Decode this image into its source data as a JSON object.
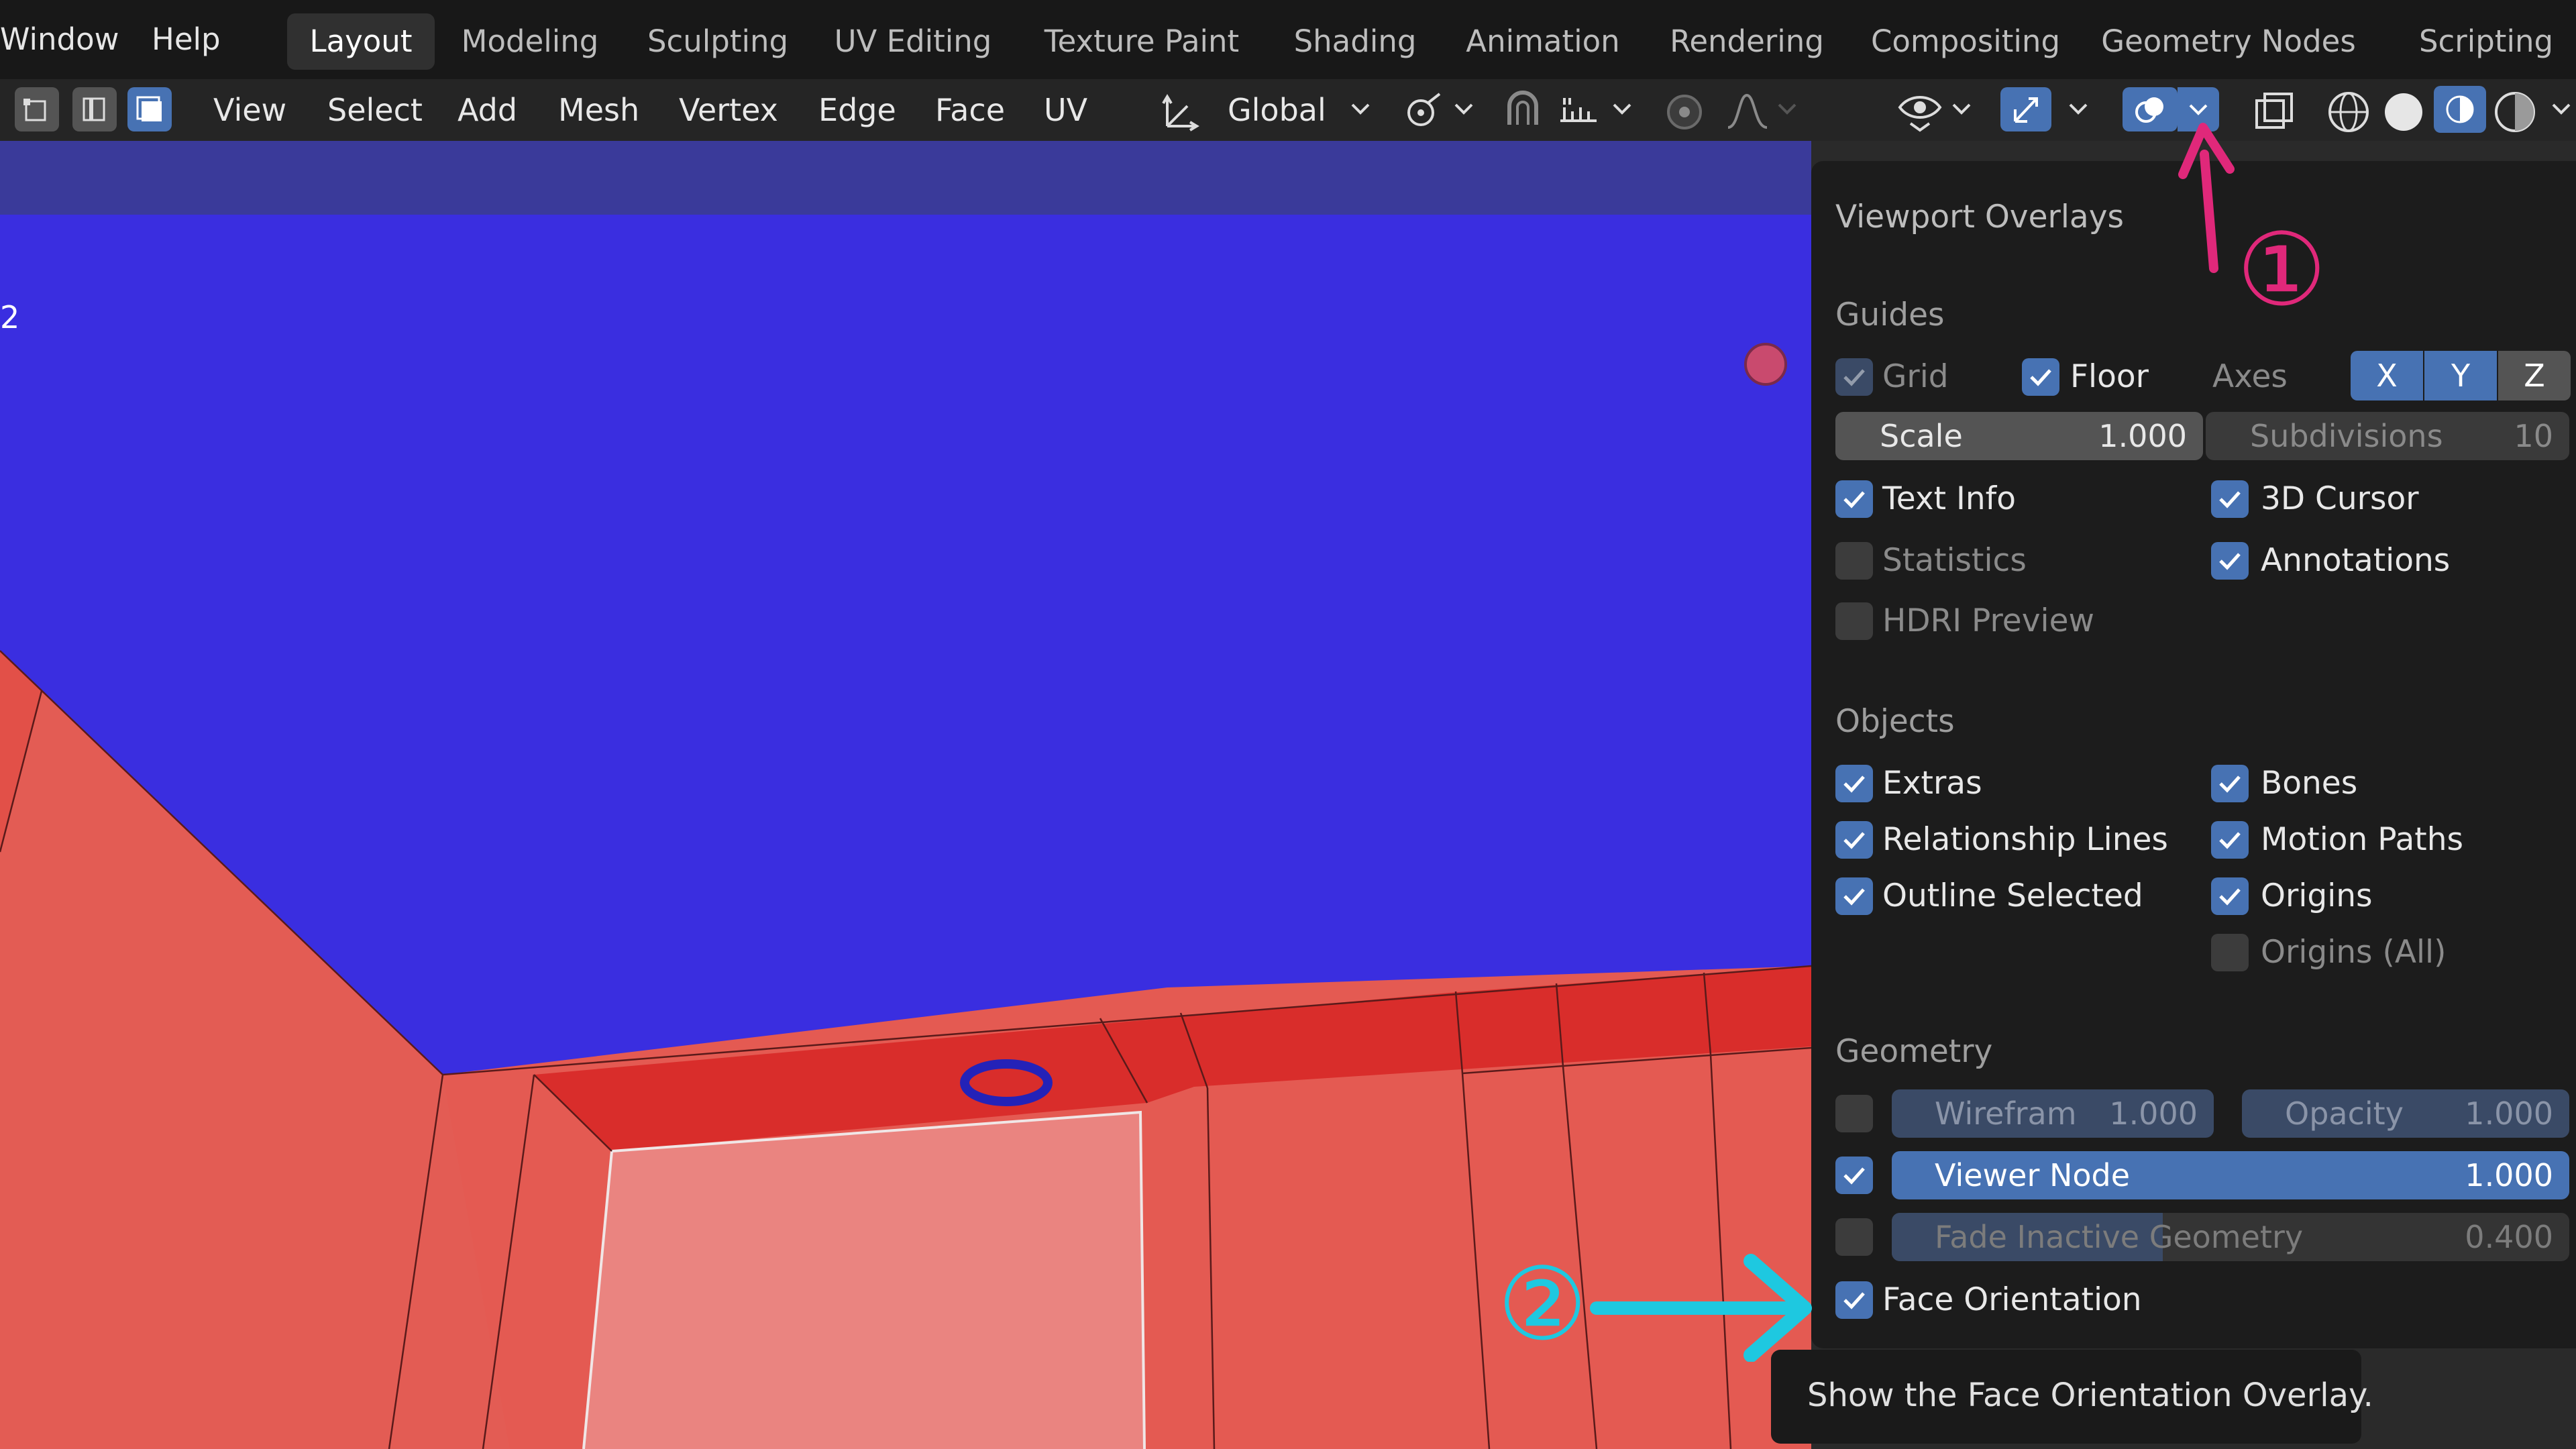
{
  "menubar": {
    "window": "Window",
    "help": "Help",
    "workspaces": [
      "Layout",
      "Modeling",
      "Sculpting",
      "UV Editing",
      "Texture Paint",
      "Shading",
      "Animation",
      "Rendering",
      "Compositing",
      "Geometry Nodes",
      "Scripting"
    ],
    "active_workspace": "Layout"
  },
  "header": {
    "menus": [
      "View",
      "Select",
      "Add",
      "Mesh",
      "Vertex",
      "Edge",
      "Face",
      "UV"
    ],
    "transform_orientation": "Global"
  },
  "viewport": {
    "corner_text": "2",
    "colors": {
      "front_face": "#e45a52",
      "back_face": "#3a2ee0"
    }
  },
  "overlays": {
    "title": "Viewport Overlays",
    "guides": {
      "heading": "Guides",
      "grid": "Grid",
      "floor": "Floor",
      "axes": "Axes",
      "axis_x": "X",
      "axis_y": "Y",
      "axis_z": "Z",
      "scale_label": "Scale",
      "scale_value": "1.000",
      "subdivisions_label": "Subdivisions",
      "subdivisions_value": "10",
      "text_info": "Text Info",
      "cursor_3d": "3D Cursor",
      "statistics": "Statistics",
      "annotations": "Annotations",
      "hdri_preview": "HDRI Preview"
    },
    "objects": {
      "heading": "Objects",
      "extras": "Extras",
      "bones": "Bones",
      "relationship_lines": "Relationship Lines",
      "motion_paths": "Motion Paths",
      "outline_selected": "Outline Selected",
      "origins": "Origins",
      "origins_all": "Origins (All)"
    },
    "geometry": {
      "heading": "Geometry",
      "wireframe_label": "Wirefram",
      "wireframe_value": "1.000",
      "opacity_label": "Opacity",
      "opacity_value": "1.000",
      "viewer_node_label": "Viewer Node",
      "viewer_node_value": "1.000",
      "fade_inactive_label": "Fade Inactive Geometry",
      "fade_inactive_value": "0.400",
      "fade_inactive_fraction": 0.4,
      "face_orientation": "Face Orientation"
    }
  },
  "tooltip": {
    "text": "Show the Face Orientation Overlay."
  },
  "annotations": {
    "step1": "①",
    "step2": "②",
    "colors": {
      "pink": "#e0287a",
      "cyan": "#1ec8e0"
    }
  }
}
